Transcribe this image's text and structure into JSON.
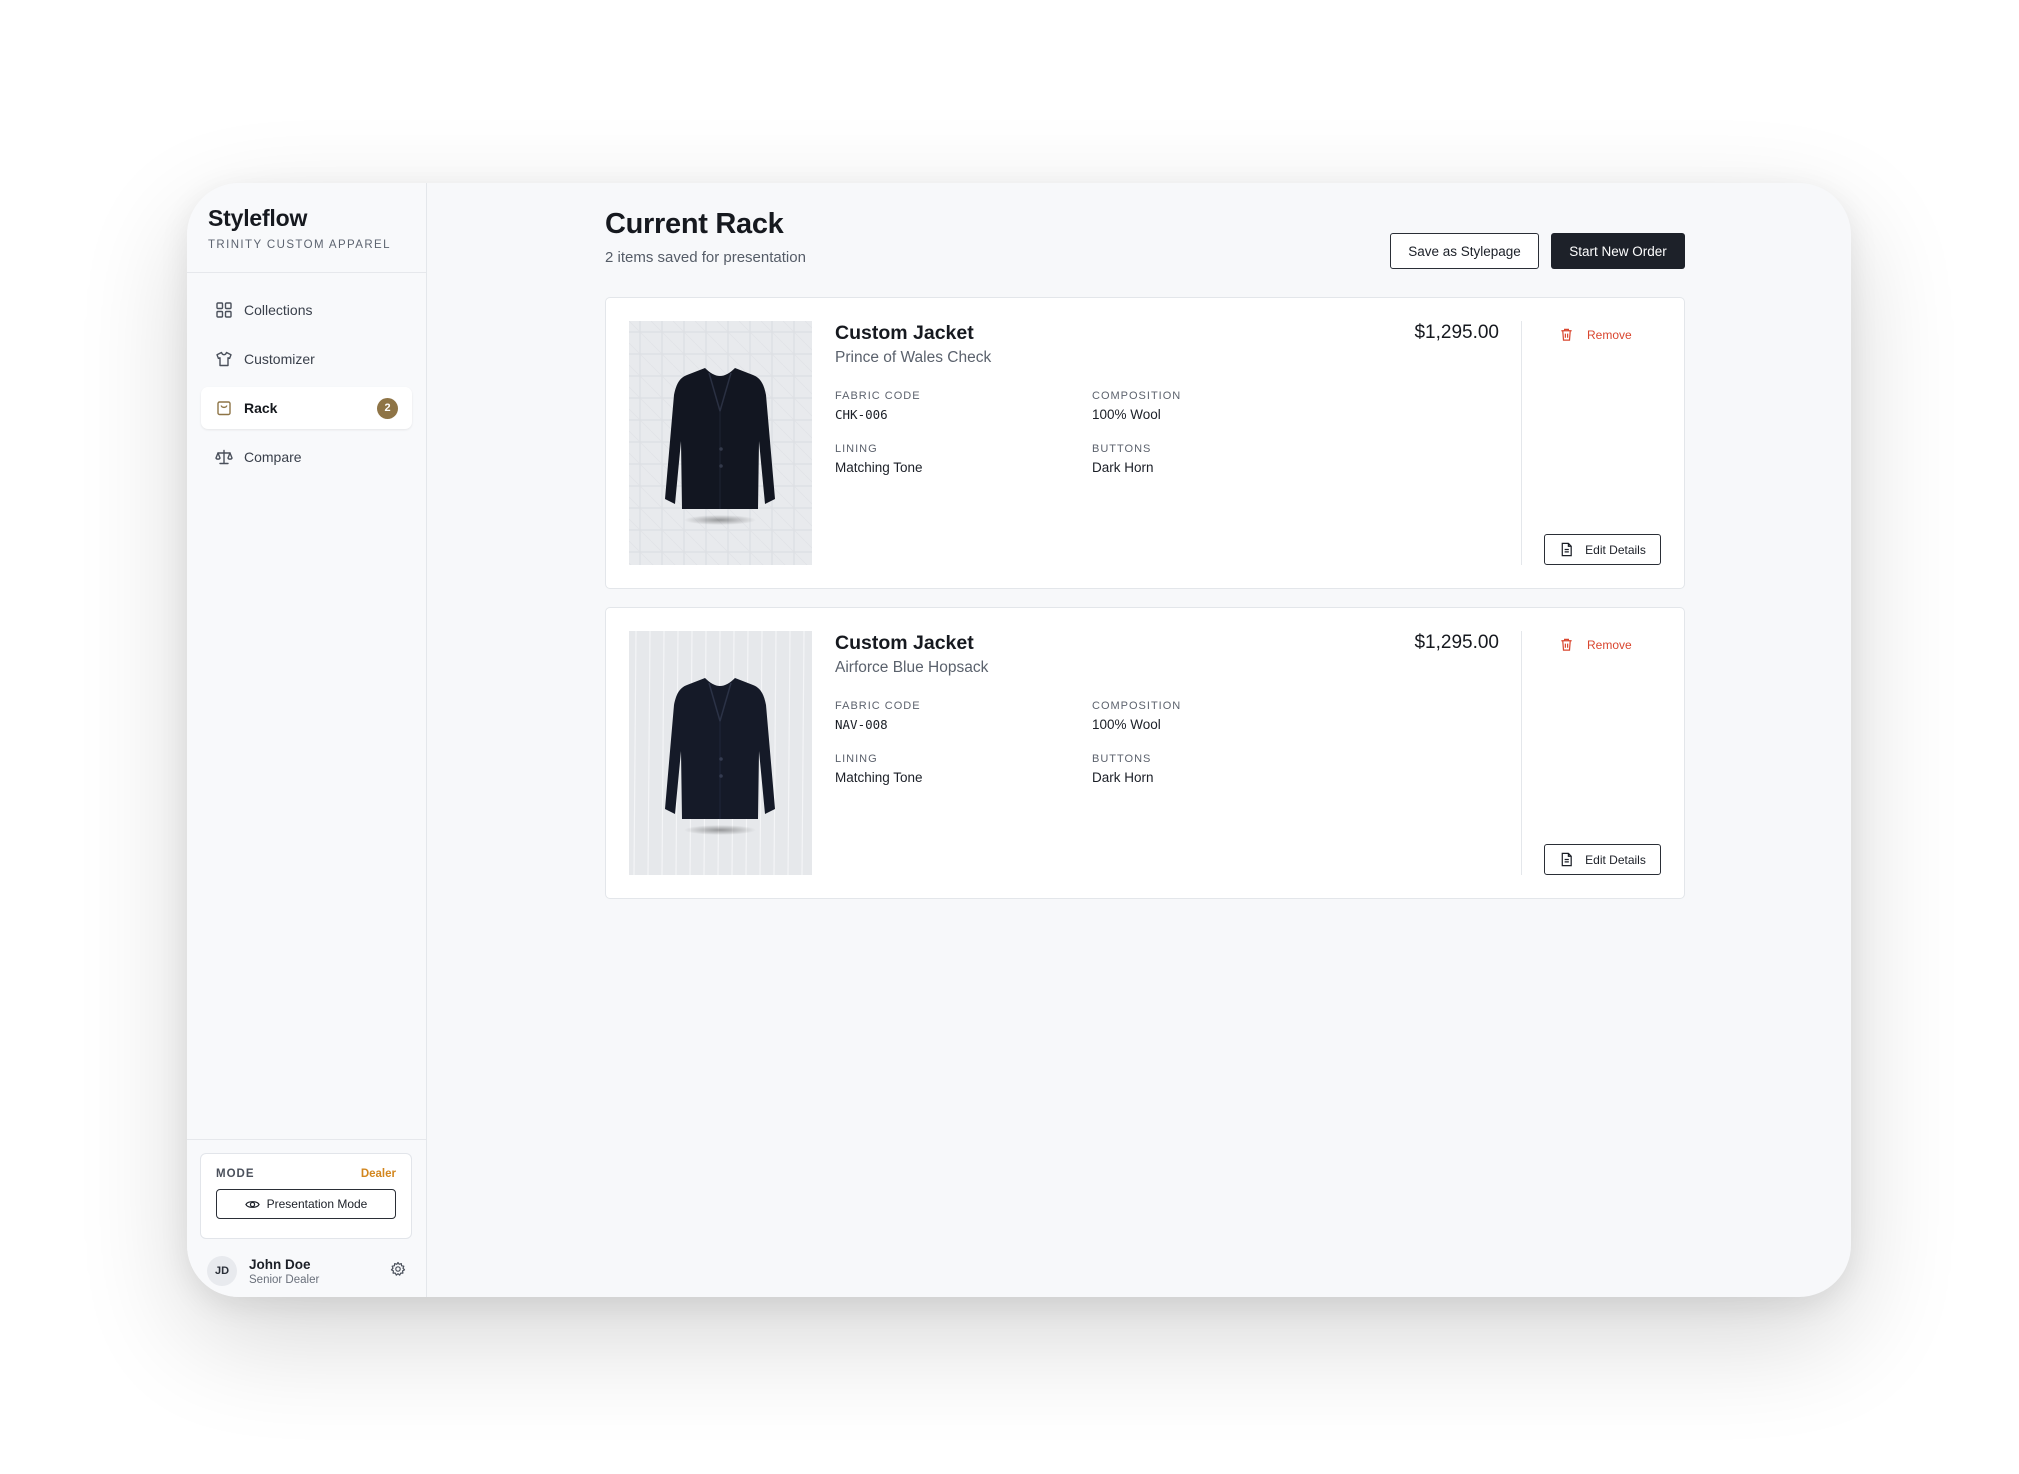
{
  "brand": {
    "name": "Styleflow",
    "subtitle": "TRINITY CUSTOM APPAREL"
  },
  "sidebar": {
    "items": [
      {
        "label": "Collections",
        "icon": "grid-icon",
        "active": false
      },
      {
        "label": "Customizer",
        "icon": "shirt-icon",
        "active": false
      },
      {
        "label": "Rack",
        "icon": "bag-icon",
        "active": true,
        "badge": "2"
      },
      {
        "label": "Compare",
        "icon": "scale-icon",
        "active": false
      }
    ]
  },
  "mode": {
    "label": "MODE",
    "value": "Dealer",
    "button": "Presentation Mode"
  },
  "user": {
    "initials": "JD",
    "name": "John Doe",
    "role": "Senior Dealer"
  },
  "header": {
    "title": "Current Rack",
    "subtitle": "2 items saved for presentation",
    "save_label": "Save as Stylepage",
    "new_order_label": "Start New Order"
  },
  "rack": {
    "remove_label": "Remove",
    "edit_label": "Edit Details",
    "items": [
      {
        "title": "Custom Jacket",
        "fabric_name": "Prince of Wales Check",
        "price": "$1,295.00",
        "fabric_code_label": "FABRIC CODE",
        "fabric_code": "CHK-006",
        "composition_label": "COMPOSITION",
        "composition": "100% Wool",
        "lining_label": "LINING",
        "lining": "Matching Tone",
        "buttons_label": "BUTTONS",
        "buttons": "Dark Horn"
      },
      {
        "title": "Custom Jacket",
        "fabric_name": "Airforce Blue Hopsack",
        "price": "$1,295.00",
        "fabric_code_label": "FABRIC CODE",
        "fabric_code": "NAV-008",
        "composition_label": "COMPOSITION",
        "composition": "100% Wool",
        "lining_label": "LINING",
        "lining": "Matching Tone",
        "buttons_label": "BUTTONS",
        "buttons": "Dark Horn"
      }
    ]
  },
  "colors": {
    "accent_badge": "#8e7446",
    "dealer": "#d2861e",
    "remove": "#d9462f",
    "primary_button": "#1d2129"
  }
}
